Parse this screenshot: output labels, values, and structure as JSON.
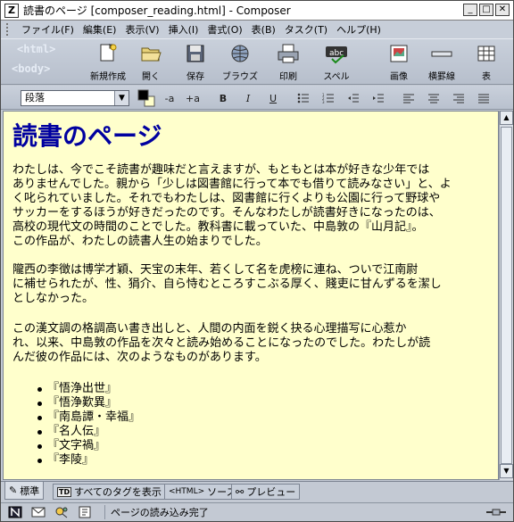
{
  "window": {
    "title": "読書のページ [composer_reading.html] - Composer",
    "title_icon": "composer-app-icon",
    "buttons": [
      "minimize",
      "maximize",
      "close"
    ]
  },
  "menu": {
    "items": [
      "ファイル(F)",
      "編集(E)",
      "表示(V)",
      "挿入(I)",
      "書式(O)",
      "表(B)",
      "タスク(T)",
      "ヘルプ(H)"
    ]
  },
  "logo": {
    "line1": "<html>",
    "line2": "<body>"
  },
  "toolbar": {
    "new": "新規作成",
    "open": "開く",
    "save": "保存",
    "browse": "ブラウズ",
    "print": "印刷",
    "spell": "スペル",
    "image": "画像",
    "hrule": "横罫線",
    "table": "表"
  },
  "format": {
    "paragraph_style": "段落",
    "smaller": "-a",
    "larger": "+a",
    "bold": "B",
    "italic": "I",
    "underline": "U",
    "text_color": "#000000",
    "bg_color": "#ffffcc"
  },
  "document": {
    "heading": "読書のページ",
    "para1_lines": [
      "わたしは、今でこそ読書が趣味だと言えますが、もともとは本が好きな少年では",
      "ありませんでした。親から「少しは図書館に行って本でも借りて読みなさい」と、よ",
      "く叱られていました。それでもわたしは、図書館に行くよりも公園に行って野球や",
      "サッカーをするほうが好きだったのです。そんなわたしが読書好きになったのは、",
      "高校の現代文の時間のことでした。教科書に載っていた、中島敦の『山月記』。",
      "この作品が、わたしの読書人生の始まりでした。"
    ],
    "para2_lines": [
      "隴西の李徴は博学才穎、天宝の末年、若くして名を虎榜に連ね、ついで江南尉",
      "に補せられたが、性、狷介、自ら恃むところすこぶる厚く、賤吏に甘んずるを潔し",
      "としなかった。"
    ],
    "para3_lines": [
      "この漢文調の格調高い書き出しと、人間の内面を鋭く抉る心理描写に心惹か",
      "れ、以来、中島敦の作品を次々と読み始めることになったのでした。わたしが読",
      "んだ彼の作品には、次のようなものがあります。"
    ],
    "books": [
      "『悟浄出世』",
      "『悟浄歎異』",
      "『南島譚・幸福』",
      "『名人伝』",
      "『文字禍』",
      "『李陵』"
    ]
  },
  "tabs": {
    "normal": "標準",
    "show_tags": "すべてのタグを表示",
    "source": "ソース",
    "preview": "プレビュー",
    "source_tag": "<HTML>"
  },
  "status": {
    "message": "ページの読み込み完了"
  }
}
